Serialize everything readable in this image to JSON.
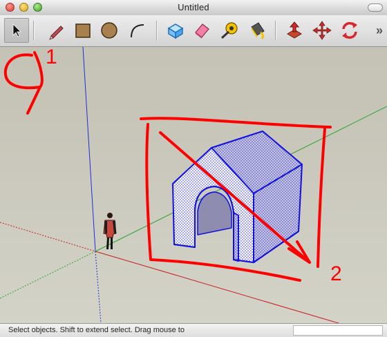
{
  "window": {
    "title": "Untitled"
  },
  "toolbar": {
    "tools": [
      {
        "name": "select",
        "icon": "select-arrow-icon",
        "active": true
      },
      {
        "name": "eraser",
        "icon": "eraser-icon",
        "active": false
      },
      {
        "name": "rectangle",
        "icon": "rectangle-icon",
        "active": false
      },
      {
        "name": "circle",
        "icon": "circle-icon",
        "active": false
      },
      {
        "name": "arc",
        "icon": "arc-icon",
        "active": false
      },
      {
        "name": "make-component",
        "icon": "component-icon",
        "active": false
      },
      {
        "name": "eraser-pink",
        "icon": "erase-icon",
        "active": false
      },
      {
        "name": "tape-measure",
        "icon": "tape-measure-icon",
        "active": false
      },
      {
        "name": "paint-bucket",
        "icon": "paint-bucket-icon",
        "active": false
      },
      {
        "name": "push-pull",
        "icon": "push-pull-icon",
        "active": false
      },
      {
        "name": "move",
        "icon": "move-icon",
        "active": false
      },
      {
        "name": "rotate",
        "icon": "rotate-icon",
        "active": false
      }
    ],
    "overflow_label": "»"
  },
  "annotations": {
    "label_1": "1",
    "label_2": "2",
    "color": "#ff0000"
  },
  "scene": {
    "axis_colors": {
      "blue": "#1a2fd8",
      "red": "#c81a1a",
      "green": "#2aa32a"
    },
    "selection_color": "#1010e0"
  },
  "status": {
    "text": "Select objects. Shift to extend select. Drag mouse to"
  }
}
